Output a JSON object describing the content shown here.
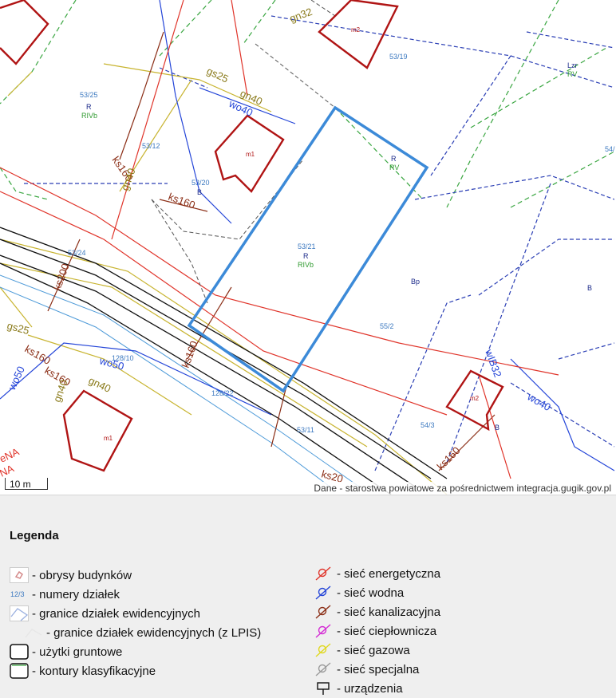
{
  "map": {
    "scale_label": "10 m",
    "attribution": "Dane - starostwa powiatowe za pośrednictwem integracja.gugik.gov.pl",
    "parcel_numbers": [
      "53/19",
      "53/25",
      "53/12",
      "53/20",
      "53/21",
      "55/2",
      "54/3",
      "53/24",
      "128/22",
      "128/10",
      "53/11",
      "54/"
    ],
    "land_use_labels": [
      "R",
      "RIVb",
      "B",
      "R",
      "RV",
      "R",
      "RIVb",
      "Bp",
      "B",
      "B",
      "Lzr",
      "RV"
    ],
    "building_labels": [
      "m2",
      "m1",
      "m2",
      "m1"
    ],
    "utility_labels": [
      "gn32",
      "gs25",
      "gn40",
      "wo40",
      "ks160",
      "gn40",
      "ks160",
      "ks200",
      "gs25",
      "ks160",
      "ks160",
      "wo50",
      "wo50",
      "gn40",
      "gn40",
      "ks160",
      "wIB32",
      "wo40",
      "ks160",
      "ks20",
      "eNA",
      "NA"
    ],
    "colors": {
      "parcel_boundary": "#2b3fb5",
      "selected_parcel": "#3c8ad8",
      "buildings": "#b01414",
      "land_use_contour": "#3aa641",
      "gas": "#c8b430",
      "sewer": "#8b2e16",
      "energy": "#e0342a",
      "water": "#2445d8"
    }
  },
  "legend": {
    "title": "Legenda",
    "left_items": [
      {
        "icon": "buildings-outline-icon",
        "label": "- obrysy budynków"
      },
      {
        "icon": "parcel-number-icon",
        "icon_text": "12/3",
        "label": "- numery działek"
      },
      {
        "icon": "parcel-boundaries-icon",
        "label": "- granice działek ewidencyjnych"
      },
      {
        "icon": "parcel-boundaries-lpis-icon",
        "label": "- granice działek ewidencyjnych (z LPIS)"
      },
      {
        "icon": "land-use-icon",
        "label": "- użytki gruntowe"
      },
      {
        "icon": "classification-contour-icon",
        "label": "- kontury klasyfikacyjne"
      }
    ],
    "right_items": [
      {
        "icon": "energy-network-icon",
        "label": "- sieć energetyczna",
        "color": "#e0342a"
      },
      {
        "icon": "water-network-icon",
        "label": "- sieć wodna",
        "color": "#2445d8"
      },
      {
        "icon": "sewer-network-icon",
        "label": "- sieć kanalizacyjna",
        "color": "#8b2e16"
      },
      {
        "icon": "heating-network-icon",
        "label": "- sieć ciepłownicza",
        "color": "#d42ad4"
      },
      {
        "icon": "gas-network-icon",
        "label": "- sieć gazowa",
        "color": "#e0d81e"
      },
      {
        "icon": "special-network-icon",
        "label": "- sieć specjalna",
        "color": "#9a9a9a"
      },
      {
        "icon": "devices-icon",
        "label": "- urządzenia",
        "color": "#111111"
      }
    ]
  }
}
